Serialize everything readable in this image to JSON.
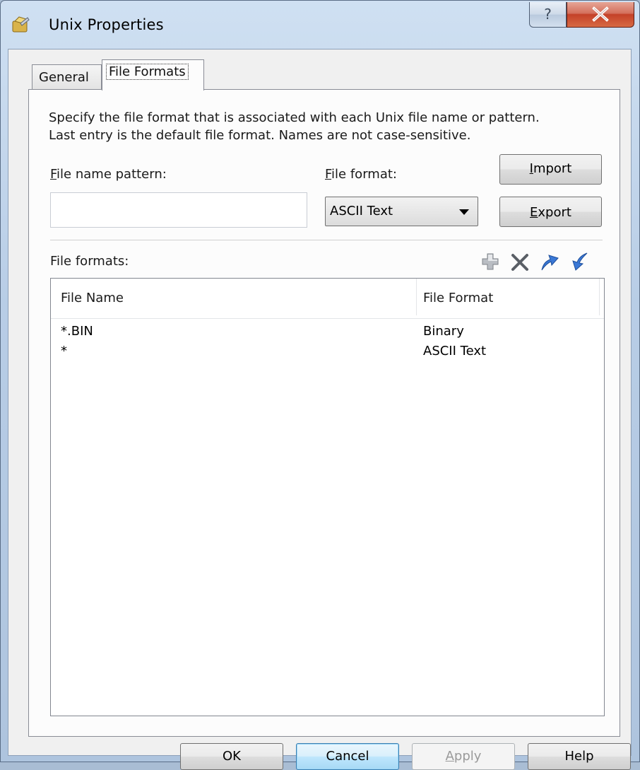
{
  "window": {
    "title": "Unix Properties",
    "help_glyph": "?",
    "close_glyph": "X"
  },
  "tabs": [
    {
      "label": "General",
      "selected": false
    },
    {
      "label": "File Formats",
      "selected": true
    }
  ],
  "description": {
    "line1": "Specify the file format that is associated with each Unix file name or pattern.",
    "line2": "Last entry is the default file format.  Names are not case-sensitive."
  },
  "pattern": {
    "label_first": "F",
    "label_rest": "ile name pattern:",
    "value": "",
    "placeholder": ""
  },
  "format": {
    "label_first": "F",
    "label_rest": "ile format:",
    "selected": "ASCII Text"
  },
  "buttons": {
    "import_first": "I",
    "import_rest": "mport",
    "export_first": "E",
    "export_rest": "xport",
    "ok": "OK",
    "cancel": "Cancel",
    "apply_first": "A",
    "apply_rest": "pply",
    "help": "Help"
  },
  "list": {
    "label": "File formats:",
    "toolbar": [
      "add-icon",
      "delete-icon",
      "move-up-icon",
      "move-down-icon"
    ],
    "columns": [
      "File Name",
      "File Format"
    ],
    "rows": [
      {
        "name": "*.BIN",
        "format": "Binary"
      },
      {
        "name": "*",
        "format": "ASCII Text"
      }
    ]
  },
  "colors": {
    "accent": "#3c7fb1",
    "close": "#c44128",
    "arrow": "#3a78d6"
  }
}
